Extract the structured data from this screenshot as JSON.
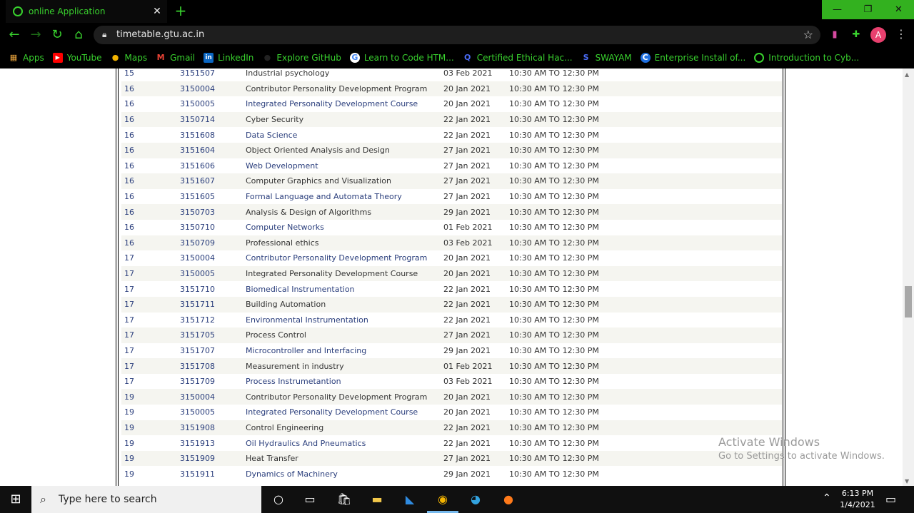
{
  "browser": {
    "tab_title": "online Application",
    "url": "timetable.gtu.ac.in",
    "avatar_initial": "A"
  },
  "bookmarks": [
    {
      "label": "Apps",
      "icon": "apps-grid-icon"
    },
    {
      "label": "YouTube",
      "icon": "youtube-icon"
    },
    {
      "label": "Maps",
      "icon": "maps-pin-icon"
    },
    {
      "label": "Gmail",
      "icon": "gmail-icon"
    },
    {
      "label": "LinkedIn",
      "icon": "linkedin-icon"
    },
    {
      "label": "Explore GitHub",
      "icon": "github-icon"
    },
    {
      "label": "Learn to Code HTM...",
      "icon": "google-icon"
    },
    {
      "label": "Certified Ethical Hac...",
      "icon": "q-icon"
    },
    {
      "label": "SWAYAM",
      "icon": "swayam-icon"
    },
    {
      "label": "Enterprise Install of...",
      "icon": "c-icon"
    },
    {
      "label": "Introduction to Cyb...",
      "icon": "globe-icon"
    }
  ],
  "timetable": {
    "rows": [
      {
        "sem": "15",
        "code": "3151507",
        "subject": "Industrial psychology",
        "date": "03 Feb 2021",
        "time": "10:30 AM TO 12:30 PM",
        "link": false
      },
      {
        "sem": "16",
        "code": "3150004",
        "subject": "Contributor Personality Development Program",
        "date": "20 Jan 2021",
        "time": "10:30 AM TO 12:30 PM",
        "link": false
      },
      {
        "sem": "16",
        "code": "3150005",
        "subject": "Integrated Personality Development Course",
        "date": "20 Jan 2021",
        "time": "10:30 AM TO 12:30 PM",
        "link": true
      },
      {
        "sem": "16",
        "code": "3150714",
        "subject": "Cyber Security",
        "date": "22 Jan 2021",
        "time": "10:30 AM TO 12:30 PM",
        "link": false
      },
      {
        "sem": "16",
        "code": "3151608",
        "subject": "Data Science",
        "date": "22 Jan 2021",
        "time": "10:30 AM TO 12:30 PM",
        "link": true
      },
      {
        "sem": "16",
        "code": "3151604",
        "subject": "Object Oriented Analysis and Design",
        "date": "27 Jan 2021",
        "time": "10:30 AM TO 12:30 PM",
        "link": false
      },
      {
        "sem": "16",
        "code": "3151606",
        "subject": "Web Development",
        "date": "27 Jan 2021",
        "time": "10:30 AM TO 12:30 PM",
        "link": true
      },
      {
        "sem": "16",
        "code": "3151607",
        "subject": "Computer Graphics and Visualization",
        "date": "27 Jan 2021",
        "time": "10:30 AM TO 12:30 PM",
        "link": false
      },
      {
        "sem": "16",
        "code": "3151605",
        "subject": "Formal Language and Automata Theory",
        "date": "27 Jan 2021",
        "time": "10:30 AM TO 12:30 PM",
        "link": true
      },
      {
        "sem": "16",
        "code": "3150703",
        "subject": "Analysis & Design of Algorithms",
        "date": "29 Jan 2021",
        "time": "10:30 AM TO 12:30 PM",
        "link": false
      },
      {
        "sem": "16",
        "code": "3150710",
        "subject": "Computer Networks",
        "date": "01 Feb 2021",
        "time": "10:30 AM TO 12:30 PM",
        "link": true
      },
      {
        "sem": "16",
        "code": "3150709",
        "subject": "Professional ethics",
        "date": "03 Feb 2021",
        "time": "10:30 AM TO 12:30 PM",
        "link": false
      },
      {
        "sem": "17",
        "code": "3150004",
        "subject": "Contributor Personality Development Program",
        "date": "20 Jan 2021",
        "time": "10:30 AM TO 12:30 PM",
        "link": true
      },
      {
        "sem": "17",
        "code": "3150005",
        "subject": "Integrated Personality Development Course",
        "date": "20 Jan 2021",
        "time": "10:30 AM TO 12:30 PM",
        "link": false
      },
      {
        "sem": "17",
        "code": "3151710",
        "subject": "Biomedical Instrumentation",
        "date": "22 Jan 2021",
        "time": "10:30 AM TO 12:30 PM",
        "link": true
      },
      {
        "sem": "17",
        "code": "3151711",
        "subject": "Building Automation",
        "date": "22 Jan 2021",
        "time": "10:30 AM TO 12:30 PM",
        "link": false
      },
      {
        "sem": "17",
        "code": "3151712",
        "subject": "Environmental Instrumentation",
        "date": "22 Jan 2021",
        "time": "10:30 AM TO 12:30 PM",
        "link": true
      },
      {
        "sem": "17",
        "code": "3151705",
        "subject": "Process Control",
        "date": "27 Jan 2021",
        "time": "10:30 AM TO 12:30 PM",
        "link": false
      },
      {
        "sem": "17",
        "code": "3151707",
        "subject": "Microcontroller and Interfacing",
        "date": "29 Jan 2021",
        "time": "10:30 AM TO 12:30 PM",
        "link": true
      },
      {
        "sem": "17",
        "code": "3151708",
        "subject": "Measurement in industry",
        "date": "01 Feb 2021",
        "time": "10:30 AM TO 12:30 PM",
        "link": false
      },
      {
        "sem": "17",
        "code": "3151709",
        "subject": "Process Instrumetantion",
        "date": "03 Feb 2021",
        "time": "10:30 AM TO 12:30 PM",
        "link": true
      },
      {
        "sem": "19",
        "code": "3150004",
        "subject": "Contributor Personality Development Program",
        "date": "20 Jan 2021",
        "time": "10:30 AM TO 12:30 PM",
        "link": false
      },
      {
        "sem": "19",
        "code": "3150005",
        "subject": "Integrated Personality Development Course",
        "date": "20 Jan 2021",
        "time": "10:30 AM TO 12:30 PM",
        "link": true
      },
      {
        "sem": "19",
        "code": "3151908",
        "subject": "Control Engineering",
        "date": "22 Jan 2021",
        "time": "10:30 AM TO 12:30 PM",
        "link": false
      },
      {
        "sem": "19",
        "code": "3151913",
        "subject": "Oil Hydraulics And Pneumatics",
        "date": "22 Jan 2021",
        "time": "10:30 AM TO 12:30 PM",
        "link": true
      },
      {
        "sem": "19",
        "code": "3151909",
        "subject": "Heat Transfer",
        "date": "27 Jan 2021",
        "time": "10:30 AM TO 12:30 PM",
        "link": false
      },
      {
        "sem": "19",
        "code": "3151911",
        "subject": "Dynamics of Machinery",
        "date": "29 Jan 2021",
        "time": "10:30 AM TO 12:30 PM",
        "link": true
      }
    ]
  },
  "watermark": {
    "line1": "Activate Windows",
    "line2": "Go to Settings to activate Windows."
  },
  "taskbar": {
    "search_placeholder": "Type here to search",
    "time": "6:13 PM",
    "date": "1/4/2021"
  },
  "colors": {
    "accent_green": "#39d22e",
    "link_blue": "#2a3e7c"
  }
}
